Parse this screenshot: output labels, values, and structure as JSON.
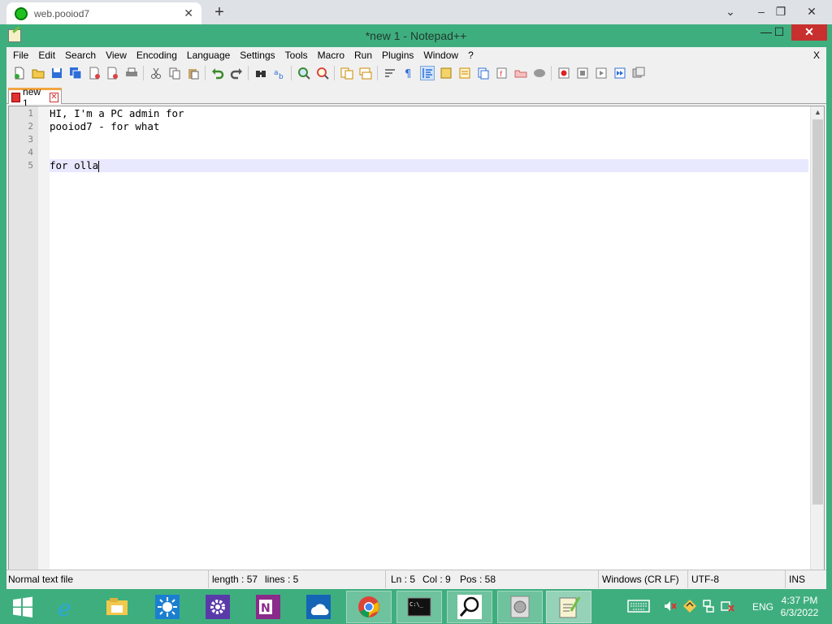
{
  "browser": {
    "tab_title": "web.pooiod7",
    "tab_close": "✕",
    "new_tab": "+",
    "controls": {
      "dropdown": "⌄",
      "minimize": "–",
      "restore": "❐",
      "close": "✕"
    }
  },
  "window": {
    "title": "*new 1 - Notepad++",
    "minimize": "—",
    "maximize": "☐",
    "close": "✕"
  },
  "menu": {
    "items": [
      "File",
      "Edit",
      "Search",
      "View",
      "Encoding",
      "Language",
      "Settings",
      "Tools",
      "Macro",
      "Run",
      "Plugins",
      "Window",
      "?"
    ],
    "close_doc": "X"
  },
  "toolbar": {
    "icons": [
      "new-file-icon",
      "open-file-icon",
      "save-icon",
      "save-all-icon",
      "close-icon",
      "close-all-icon",
      "print-icon",
      "cut-icon",
      "copy-icon",
      "paste-icon",
      "undo-icon",
      "redo-icon",
      "find-icon",
      "replace-icon",
      "zoom-in-icon",
      "zoom-out-icon",
      "sync-v-icon",
      "sync-h-icon",
      "word-wrap-icon",
      "show-all-chars-icon",
      "indent-guide-icon",
      "udl-icon",
      "doc-map-icon",
      "function-list-icon",
      "folder-workspace-icon",
      "monitoring-icon",
      "record-macro-icon",
      "stop-macro-icon",
      "play-macro-icon",
      "run-macro-multiple-icon",
      "save-macro-icon"
    ]
  },
  "doc_tab": {
    "label": "new 1"
  },
  "editor": {
    "lines": [
      {
        "num": "1",
        "text": "HI, I'm a PC admin for"
      },
      {
        "num": "2",
        "text": "pooiod7 - for what"
      },
      {
        "num": "3",
        "text": ""
      },
      {
        "num": "4",
        "text": ""
      },
      {
        "num": "5",
        "text": "for olla"
      }
    ],
    "current_line": 5
  },
  "statusbar": {
    "filetype": "Normal text file",
    "length": "length : 57",
    "lines": "lines : 5",
    "ln": "Ln : 5",
    "col": "Col : 9",
    "pos": "Pos : 58",
    "eol": "Windows (CR LF)",
    "encoding": "UTF-8",
    "mode": "INS"
  },
  "taskbar": {
    "apps": [
      "windows-start-icon",
      "internet-explorer-icon",
      "file-explorer-icon",
      "weather-icon",
      "settings-icon",
      "onenote-icon",
      "onedrive-icon",
      "chrome-icon",
      "command-prompt-icon",
      "magnifier-icon",
      "disk-icon",
      "notepadpp-icon"
    ],
    "language": "ENG",
    "time": "4:37 PM",
    "date": "6/3/2022"
  },
  "colors": {
    "accent": "#3fae7e",
    "current_line": "#e8e8ff",
    "close_red": "#c7302f"
  }
}
